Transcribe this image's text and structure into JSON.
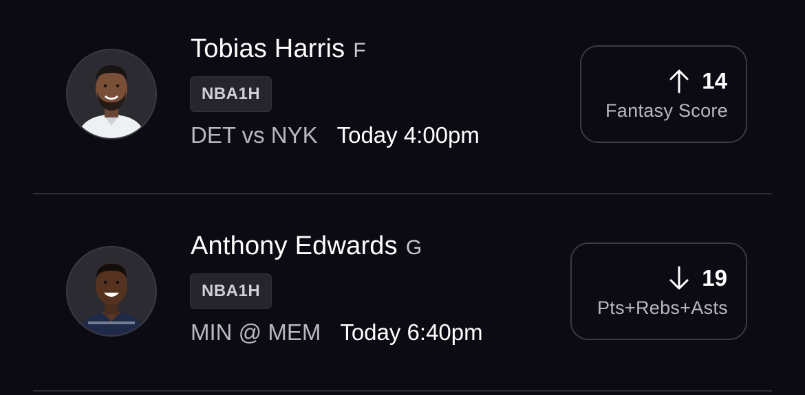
{
  "picks": [
    {
      "player_name": "Tobias Harris",
      "position": "F",
      "league": "NBA1H",
      "matchup": "DET vs NYK",
      "game_time": "Today 4:00pm",
      "direction": "up",
      "direction_icon": "arrow-up-icon",
      "line_value": "14",
      "stat_type": "Fantasy Score",
      "jersey_color": "#eef1f4"
    },
    {
      "player_name": "Anthony Edwards",
      "position": "G",
      "league": "NBA1H",
      "matchup": "MIN @ MEM",
      "game_time": "Today 6:40pm",
      "direction": "down",
      "direction_icon": "arrow-down-icon",
      "line_value": "19",
      "stat_type": "Pts+Rebs+Asts",
      "jersey_color": "#1e2a48"
    }
  ],
  "colors": {
    "background": "#0c0b14",
    "card_border": "#3a3945",
    "badge_background": "#26252d",
    "muted_text": "#b8b8c0"
  }
}
